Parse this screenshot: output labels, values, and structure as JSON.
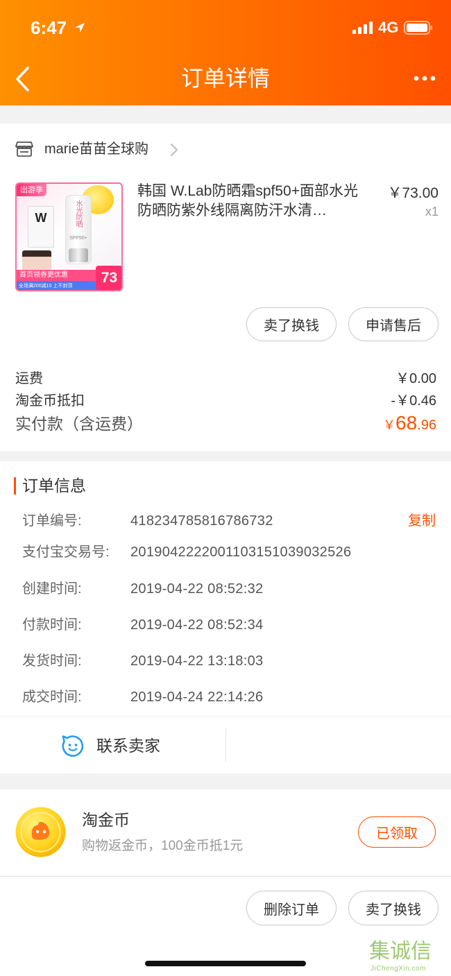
{
  "colors": {
    "accent": "#ff5000",
    "header_start": "#ff9000",
    "header_end": "#ff5000",
    "contact_icon": "#2a9bf2",
    "coin": "#ffd21f"
  },
  "status_bar": {
    "time": "6:47",
    "network": "4G",
    "icons": [
      "location-arrow-icon",
      "signal-icon",
      "battery-icon"
    ]
  },
  "header": {
    "title": "订单详情",
    "back_icon": "chevron-left-icon",
    "more_icon": "more-dots-icon"
  },
  "shop": {
    "name": "marie苗苗全球购",
    "icon": "store-icon",
    "product": {
      "title": "韩国 W.Lab防晒霜spf50+面部水光防晒防紫外线隔离防汗水清…",
      "price": "￥73.00",
      "quantity": "x1",
      "image": {
        "badge": "出游季",
        "brand": "W",
        "bottle_text": "水光防晒",
        "spf": "SPF50+",
        "coupon": "首页领券更优惠",
        "promo": "全场满200减10 上不封顶",
        "price_tag": "73"
      }
    },
    "actions": [
      {
        "label": "卖了换钱"
      },
      {
        "label": "申请售后"
      }
    ],
    "fees": [
      {
        "label": "运费",
        "value": "￥0.00"
      },
      {
        "label": "淘金币抵扣",
        "value": "-￥0.46"
      }
    ],
    "total": {
      "label": "实付款（含运费）",
      "currency": "￥",
      "integer": "68",
      "decimal": ".96"
    }
  },
  "order_info": {
    "title": "订单信息",
    "copy_label": "复制",
    "rows": [
      {
        "label": "订单编号:",
        "value": "418234785816786732"
      },
      {
        "label": "支付宝交易号:",
        "value": "2019042222001103151039032526"
      },
      {
        "label": "创建时间:",
        "value": "2019-04-22 08:52:32"
      },
      {
        "label": "付款时间:",
        "value": "2019-04-22 08:52:34"
      },
      {
        "label": "发货时间:",
        "value": "2019-04-22 13:18:03"
      },
      {
        "label": "成交时间:",
        "value": "2019-04-24 22:14:26"
      }
    ],
    "contact_label": "联系卖家",
    "contact_icon": "chat-face-icon"
  },
  "taojinbi": {
    "title": "淘金币",
    "description": "购物返金币，100金币抵1元",
    "button": "已领取",
    "icon": "gold-coin-icon"
  },
  "bottom_actions": [
    {
      "label": "删除订单"
    },
    {
      "label": "卖了换钱"
    }
  ],
  "watermark": {
    "text_cn": "集诚信",
    "text_en": "JiChengXin.com"
  }
}
